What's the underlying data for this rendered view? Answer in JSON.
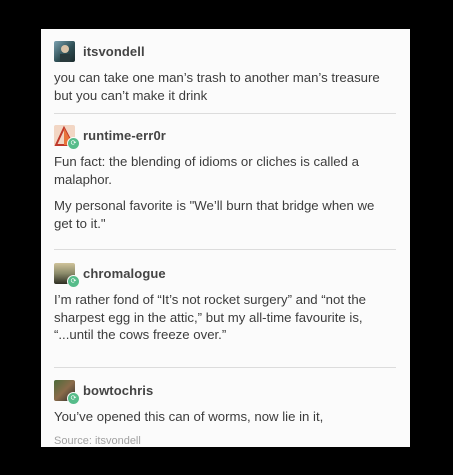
{
  "posts": [
    {
      "username": "itsvondell",
      "paragraphs": [
        "you can take one man’s trash to another man’s treasure but you can’t make it drink"
      ]
    },
    {
      "username": "runtime-err0r",
      "paragraphs": [
        "Fun fact: the blending of idioms or cliches is called a malaphor.",
        "My personal favorite is \"We’ll burn that bridge when we get to it.\""
      ]
    },
    {
      "username": "chromalogue",
      "paragraphs": [
        "I’m rather fond of “It’s not rocket surgery” and “not the sharpest egg in the attic,” but my all-time favourite is, “...until the cows freeze over.”"
      ]
    },
    {
      "username": "bowtochris",
      "paragraphs": [
        "You’ve opened this can of worms, now lie in it,"
      ]
    }
  ],
  "source": "Source: itsvondell",
  "icons": {
    "reblog": "reblog-icon"
  }
}
